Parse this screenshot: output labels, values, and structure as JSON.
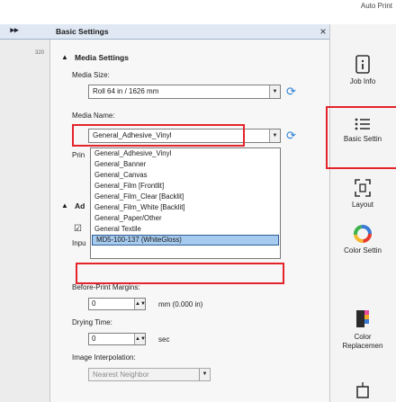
{
  "top_bar": {
    "label": "Auto Print"
  },
  "gutter": {
    "collapse_glyph": "▸▸",
    "ruler_value": "320"
  },
  "panel": {
    "title": "Basic Settings",
    "close_glyph": "×",
    "media_settings": {
      "header": "Media Settings",
      "media_size_label": "Media Size:",
      "media_size_value": "Roll 64 in / 1626 mm",
      "media_name_label": "Media Name:",
      "media_name_value": "General_Adhesive_Vinyl",
      "hidden_label_fragment": "Prin",
      "dropdown_options": [
        "General_Adhesive_Vinyl",
        "General_Banner",
        "General_Canvas",
        "General_Film [Frontlit]",
        "General_Film_Clear [Backlit]",
        "General_Film_White [Backlit]",
        "General_Paper/Other",
        "General Textile",
        "MD5-100-137 (WhiteGloss)"
      ]
    },
    "advanced": {
      "header_fragment": "Ad",
      "checkbox_mark": "☑",
      "input_fragment": "Inpu",
      "before_print_label": "Before-Print Margins:",
      "before_print_value": "0",
      "before_print_unit": "mm (0.000 in)",
      "drying_time_label": "Drying Time:",
      "drying_time_value": "0",
      "drying_time_unit": "sec",
      "interp_label": "Image Interpolation:",
      "interp_value": "Nearest Neighbor"
    }
  },
  "right_nav": [
    {
      "name": "job-info",
      "label": "Job Info"
    },
    {
      "name": "basic-settings",
      "label": "Basic Settin"
    },
    {
      "name": "layout",
      "label": "Layout"
    },
    {
      "name": "color-settings",
      "label": "Color Settin"
    },
    {
      "name": "color-replacement",
      "label": "Color",
      "label2": "Replacemen"
    }
  ],
  "colors": {
    "accent": "#2b7fd4",
    "highlight": "#e3242b",
    "selection": "#a7cbee"
  }
}
